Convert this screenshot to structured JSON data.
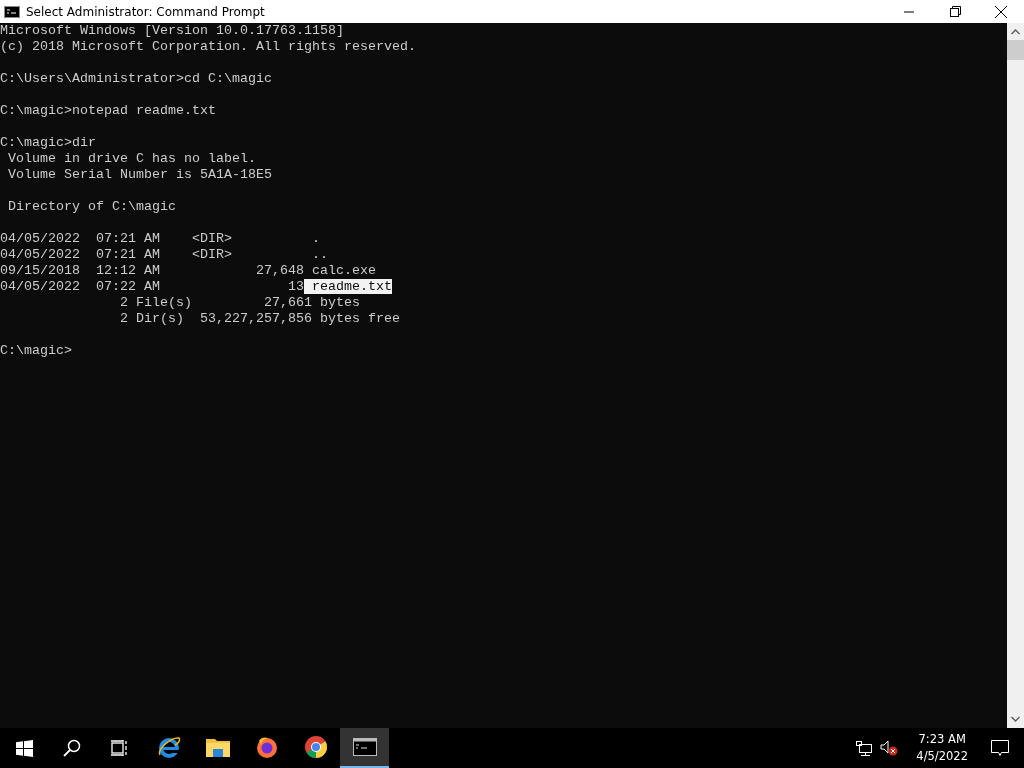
{
  "window": {
    "title": "Select Administrator: Command Prompt"
  },
  "console": {
    "blocks": [
      [
        [
          {
            "text": "Microsoft Windows [Version 10.0.17763.1158]",
            "selected": false
          }
        ],
        [
          {
            "text": "(c) 2018 Microsoft Corporation. All rights reserved.",
            "selected": false
          }
        ]
      ],
      [
        [
          {
            "text": "C:\\Users\\Administrator>cd C:\\magic",
            "selected": false
          }
        ]
      ],
      [
        [
          {
            "text": "C:\\magic>notepad readme.txt",
            "selected": false
          }
        ]
      ],
      [
        [
          {
            "text": "C:\\magic>dir",
            "selected": false
          }
        ],
        [
          {
            "text": " Volume in drive C has no label.",
            "selected": false
          }
        ],
        [
          {
            "text": " Volume Serial Number is 5A1A-18E5",
            "selected": false
          }
        ]
      ],
      [
        [
          {
            "text": " Directory of C:\\magic",
            "selected": false
          }
        ]
      ],
      [
        [
          {
            "text": "04/05/2022  07:21 AM    <DIR>          .",
            "selected": false
          }
        ],
        [
          {
            "text": "04/05/2022  07:21 AM    <DIR>          ..",
            "selected": false
          }
        ],
        [
          {
            "text": "09/15/2018  12:12 AM            27,648 calc.exe",
            "selected": false
          }
        ],
        [
          {
            "text": "04/05/2022  07:22 AM                13",
            "selected": false
          },
          {
            "text": " readme.txt",
            "selected": true
          }
        ],
        [
          {
            "text": "               2 File(s)         27,661 bytes",
            "selected": false
          }
        ],
        [
          {
            "text": "               2 Dir(s)  53,227,257,856 bytes free",
            "selected": false
          }
        ]
      ],
      [
        [
          {
            "text": "C:\\magic>",
            "selected": false
          }
        ]
      ]
    ]
  },
  "taskbar": {
    "apps": [
      {
        "kind": "ie",
        "selected": false
      },
      {
        "kind": "folder",
        "selected": false
      },
      {
        "kind": "firefox",
        "selected": false
      },
      {
        "kind": "chrome",
        "selected": false
      },
      {
        "kind": "cmd",
        "selected": true
      }
    ],
    "time": "7:23 AM",
    "date": "4/5/2022"
  }
}
